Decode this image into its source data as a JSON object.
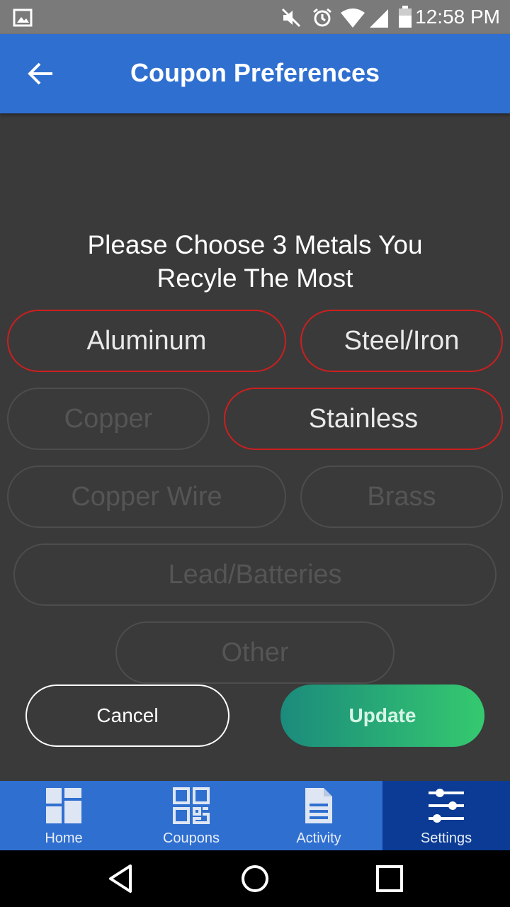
{
  "status_bar": {
    "time": "12:58 PM",
    "icons": [
      "image-notification-icon",
      "mute-icon",
      "alarm-icon",
      "wifi-icon",
      "signal-icon",
      "battery-icon"
    ]
  },
  "header": {
    "title": "Coupon Preferences",
    "back_icon": "arrow-left-icon"
  },
  "prompt": {
    "line1": "Please Choose 3 Metals You",
    "line2": "Recyle The Most"
  },
  "metals": [
    {
      "label": "Aluminum",
      "selected": true
    },
    {
      "label": "Steel/Iron",
      "selected": true
    },
    {
      "label": "Copper",
      "selected": false
    },
    {
      "label": "Stainless",
      "selected": true
    },
    {
      "label": "Copper Wire",
      "selected": false
    },
    {
      "label": "Brass",
      "selected": false
    },
    {
      "label": "Lead/Batteries",
      "selected": false
    },
    {
      "label": "Other",
      "selected": false
    }
  ],
  "actions": {
    "cancel": "Cancel",
    "update": "Update"
  },
  "tabs": [
    {
      "label": "Home",
      "icon": "dashboard-icon",
      "active": false
    },
    {
      "label": "Coupons",
      "icon": "qr-code-icon",
      "active": false
    },
    {
      "label": "Activity",
      "icon": "document-icon",
      "active": false
    },
    {
      "label": "Settings",
      "icon": "sliders-icon",
      "active": true
    }
  ],
  "colors": {
    "app_bar": "#2f6fd0",
    "active_tab": "#0b3b94",
    "selected_border": "#cc1f1f",
    "background": "#3a3a3a",
    "update_gradient_start": "#1b8b7c",
    "update_gradient_end": "#35c96f"
  }
}
